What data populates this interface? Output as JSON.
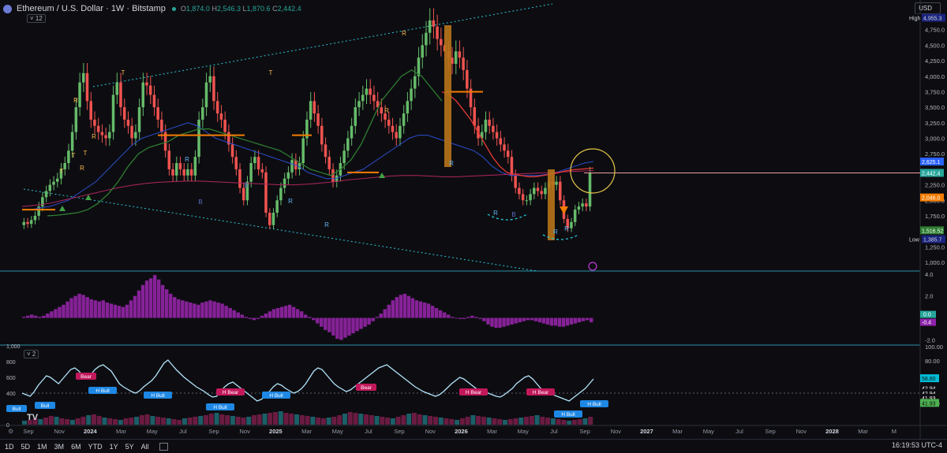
{
  "header": {
    "symbol": "Ethereum / U.S. Dollar · 1W · Bitstamp",
    "o_label": "O",
    "o": "1,874.0",
    "h_label": "H",
    "h": "2,546.3",
    "l_label": "L",
    "l": "1,870.6",
    "c_label": "C",
    "c": "2,442.4",
    "indicator_count": "12"
  },
  "currency": "USD",
  "price_axis": {
    "ticks": [
      "4,750.0",
      "4,500.0",
      "4,250.0",
      "4,000.0",
      "3,750.0",
      "3,500.0",
      "3,250.0",
      "3,000.0",
      "2,750.0",
      "2,250.0",
      "2,000.0",
      "1,750.0",
      "1,250.0",
      "1,000.0"
    ],
    "tick_values": [
      4750,
      4500,
      4250,
      4000,
      3750,
      3500,
      3250,
      3000,
      2750,
      2250,
      2000,
      1750,
      1250,
      1000
    ],
    "high_label": "High",
    "high_value": "4,955.3",
    "low_label": "Low",
    "low_value": "1,385.7",
    "tags": [
      {
        "text": "2,625.1",
        "color": "#2962ff",
        "value": 2625
      },
      {
        "text": "2,442.4",
        "color": "#26a69a",
        "value": 2442
      },
      {
        "text": "2,046.0",
        "color": "#f57c00",
        "value": 2046
      },
      {
        "text": "1,516.52",
        "color": "#2e7d32",
        "value": 1516
      }
    ]
  },
  "macd_axis": {
    "ticks": [
      "4.0",
      "2.0",
      "-2.0"
    ],
    "tick_values": [
      4,
      2,
      -2
    ],
    "zero_tag": "0.0",
    "last_tag": "-0.4"
  },
  "rsi_axis": {
    "ticks": [
      "100.00",
      "80.00",
      "20.00"
    ],
    "tick_values": [
      100,
      80,
      20
    ],
    "tags": [
      {
        "text": "58.80",
        "color": "#00bcd4",
        "value": 58.8
      },
      {
        "text": "42.94",
        "color": "#ffffff",
        "value": 45
      },
      {
        "text": "42.94",
        "color": "#ffffff",
        "value": 38
      },
      {
        "text": "41.93",
        "color": "#ffffff",
        "value": 31
      },
      {
        "text": "41.93",
        "color": "#4caf50",
        "value": 24
      }
    ],
    "left_ticks": [
      "1,000",
      "800",
      "600",
      "400",
      "200",
      "0"
    ],
    "left_values": [
      1000,
      800,
      600,
      400,
      200,
      0
    ],
    "pane_count": "2"
  },
  "time_axis": {
    "labels": [
      "Sep",
      "Nov",
      "2024",
      "Mar",
      "May",
      "Jul",
      "Sep",
      "Nov",
      "2025",
      "Mar",
      "May",
      "Jul",
      "Sep",
      "Nov",
      "2026",
      "Mar",
      "May",
      "Jul",
      "Sep",
      "Nov",
      "2027",
      "Mar",
      "May",
      "Jul",
      "Sep",
      "Nov",
      "2028",
      "Mar",
      "M"
    ],
    "bold": [
      "2024",
      "2025",
      "2026",
      "2027",
      "2028"
    ]
  },
  "timeframes": [
    "1D",
    "5D",
    "1M",
    "3M",
    "6M",
    "YTD",
    "1Y",
    "5Y",
    "All"
  ],
  "clock": "16:19:53 UTC-4",
  "markers": {
    "T": "T",
    "R": "R",
    "B": "B",
    "bull": "Bull",
    "hbull": "H Bull",
    "bear": "Bear",
    "hbear": "H Bear"
  },
  "chart_data": [
    {
      "type": "candlestick",
      "title": "Ethereum / U.S. Dollar · 1W · Bitstamp",
      "x_range": [
        "2023-08",
        "2028-05"
      ],
      "ylim": [
        1000,
        5000
      ],
      "series": [
        {
          "name": "",
          "close": [
            1650,
            1620,
            1680,
            1750,
            1900,
            2050,
            2150,
            2250,
            2300,
            2350,
            2500,
            2600,
            2800,
            3100,
            3500,
            3900,
            4050,
            3600,
            3300,
            3200,
            3100,
            3050,
            3000,
            3100,
            3700,
            3900,
            3500,
            3300,
            3200,
            3000,
            3100,
            3500,
            3900,
            3850,
            3700,
            3500,
            3300,
            3100,
            2800,
            2500,
            2400,
            2600,
            2500,
            2400,
            2500,
            2400,
            2700,
            3300,
            3500,
            3900,
            4000,
            3600,
            3400,
            3300,
            3100,
            2900,
            2700,
            2500,
            2200,
            2000,
            2300,
            2600,
            2700,
            2500,
            2450,
            1800,
            1600,
            1800,
            2000,
            2200,
            2350,
            2450,
            2650,
            2500,
            2600,
            3000,
            3300,
            3600,
            3400,
            3200,
            2900,
            2700,
            2500,
            2300,
            2400,
            2600,
            2800,
            3000,
            3200,
            3500,
            3600,
            3700,
            3800,
            3700,
            3600,
            3500,
            3400,
            3300,
            3200,
            3100,
            3000,
            3200,
            3400,
            3600,
            3800,
            4000,
            4300,
            4500,
            4700,
            4900,
            4800,
            4600,
            4500,
            4400,
            4300,
            4200,
            4400,
            4300,
            4100,
            3800,
            3500,
            3200,
            3000,
            3100,
            3300,
            3200,
            3100,
            3000,
            2900,
            2800,
            2700,
            2400,
            2200,
            2100,
            2000,
            2000,
            2100,
            2200,
            2150,
            2100,
            2200,
            2300,
            2250,
            2300,
            2000,
            1700,
            1550,
            1650,
            1850,
            1900,
            1950,
            1900,
            2442
          ]
        },
        {
          "name": "",
          "values": [
            1850,
            1850,
            1880,
            1900,
            1950,
            2000,
            2100,
            2200,
            2300,
            2450,
            2600,
            2750,
            2900,
            3000,
            3050,
            3100,
            3150,
            3200,
            3250,
            3200,
            3100,
            3000,
            2950,
            2900,
            2850,
            2800,
            2750,
            2700,
            2650,
            2600,
            2550,
            2450,
            2400,
            2350,
            2350,
            2400,
            2450,
            2500,
            2600,
            2700,
            2800,
            2900,
            3000,
            3050,
            3050,
            3000,
            2950,
            2900,
            2850,
            2800,
            2700,
            2550,
            2450,
            2400,
            2400,
            2400,
            2400,
            2420,
            2450,
            2500,
            2550,
            2600,
            2625
          ]
        },
        {
          "name": "",
          "values": [
            1900,
            1920,
            1950,
            2000,
            2050,
            2100,
            2150,
            2200,
            2240,
            2270,
            2290,
            2300,
            2310,
            2310,
            2300,
            2290,
            2280,
            2270,
            2260,
            2250,
            2250,
            2260,
            2280,
            2300,
            2330,
            2350,
            2370,
            2390,
            2400,
            2400,
            2390,
            2380,
            2380,
            2390,
            2400,
            2410,
            2420,
            2430,
            2440,
            2450,
            2460,
            2470,
            2480
          ]
        },
        {
          "name": "",
          "values": [
            1750,
            1760,
            1780,
            1800,
            1850,
            1950,
            2100,
            2300,
            2550,
            2750,
            2850,
            2900,
            2950,
            3050,
            3100,
            3150,
            3150,
            3100,
            3050,
            3000,
            2950,
            2900,
            2850,
            2800,
            2700,
            2600,
            2500,
            2450,
            2400,
            2500,
            2650,
            2900,
            3250,
            3600,
            3800,
            4000,
            4100,
            4000,
            3800,
            3600
          ]
        },
        {
          "name": "",
          "values": [
            3750,
            3700,
            3600,
            3450,
            3300,
            3100,
            2900,
            2700,
            2550,
            2450,
            2420,
            2400,
            2380,
            2380,
            2400,
            2420,
            2440,
            2470,
            2490,
            2500,
            2510,
            2520
          ]
        }
      ]
    },
    {
      "type": "bar",
      "title": "",
      "ylim": [
        -2.4,
        4.2
      ],
      "series": [
        {
          "name": "",
          "values": [
            0.1,
            0.2,
            0.3,
            0.2,
            0.1,
            0.2,
            0.4,
            0.6,
            0.8,
            1.0,
            1.2,
            1.5,
            1.8,
            2.0,
            2.2,
            2.1,
            1.9,
            1.7,
            1.6,
            1.5,
            1.6,
            1.4,
            1.3,
            1.2,
            1.1,
            1.0,
            1.2,
            1.6,
            2.0,
            2.5,
            3.0,
            3.4,
            3.6,
            3.9,
            3.5,
            3.0,
            2.6,
            2.2,
            1.9,
            1.7,
            1.6,
            1.5,
            1.4,
            1.3,
            1.2,
            1.4,
            1.5,
            1.6,
            1.5,
            1.4,
            1.3,
            1.1,
            0.9,
            0.7,
            0.5,
            0.3,
            0.1,
            -0.1,
            -0.2,
            -0.1,
            0.2,
            0.4,
            0.6,
            0.8,
            0.9,
            1.0,
            1.1,
            1.2,
            1.0,
            0.8,
            0.6,
            0.3,
            0.1,
            -0.2,
            -0.5,
            -0.8,
            -1.1,
            -1.3,
            -1.6,
            -1.9,
            -2.0,
            -1.8,
            -1.6,
            -1.4,
            -1.2,
            -1.0,
            -0.8,
            -0.6,
            -0.3,
            0.1,
            0.4,
            0.8,
            1.2,
            1.6,
            1.9,
            2.1,
            2.2,
            2.0,
            1.8,
            1.6,
            1.5,
            1.4,
            1.3,
            1.1,
            0.9,
            0.7,
            0.5,
            0.3,
            0.1,
            0.0,
            -0.1,
            -0.1,
            0.1,
            0.2,
            0.1,
            -0.1,
            -0.3,
            -0.6,
            -0.8,
            -0.9,
            -0.9,
            -0.8,
            -0.7,
            -0.6,
            -0.5,
            -0.4,
            -0.3,
            -0.2,
            -0.2,
            -0.3,
            -0.4,
            -0.5,
            -0.6,
            -0.7,
            -0.7,
            -0.8,
            -0.8,
            -0.7,
            -0.6,
            -0.5,
            -0.4,
            -0.3,
            -0.2,
            -0.4
          ]
        }
      ]
    },
    {
      "type": "line",
      "title": "",
      "ylim": [
        0,
        1000
      ],
      "series": [
        {
          "name": "",
          "values": [
            400,
            380,
            360,
            420,
            500,
            560,
            620,
            600,
            560,
            520,
            580,
            640,
            700,
            720,
            680,
            620,
            600,
            640,
            700,
            740,
            760,
            720,
            680,
            600,
            520,
            480,
            450,
            420,
            400,
            430,
            480,
            520,
            560,
            620,
            700,
            780,
            820,
            760,
            700,
            650,
            600,
            560,
            520,
            480,
            450,
            420,
            380,
            350,
            360,
            420,
            480,
            520,
            540,
            500,
            460,
            420,
            380,
            340,
            300,
            320,
            360,
            420,
            480,
            520,
            500,
            460,
            430,
            400,
            420,
            460,
            520,
            600,
            680,
            720,
            700,
            640,
            580,
            520,
            480,
            450,
            420,
            440,
            480,
            520,
            560,
            600,
            640,
            680,
            720,
            740,
            760,
            720,
            680,
            640,
            600,
            560,
            520,
            480,
            450,
            420,
            400,
            380,
            360,
            380,
            420,
            470,
            520,
            560,
            600,
            580,
            540,
            500,
            460,
            440,
            420,
            400,
            380,
            360,
            350,
            380,
            420,
            460,
            520,
            560,
            600,
            620,
            580,
            520,
            460,
            420,
            400,
            380,
            360,
            340,
            320,
            300,
            340,
            380,
            420,
            460,
            520,
            580
          ]
        },
        {
          "name": "",
          "values": [
            50,
            60,
            80,
            70,
            90,
            110,
            100,
            80,
            70,
            60,
            80,
            100,
            120,
            130,
            110,
            90,
            80,
            70,
            60,
            80,
            90,
            100,
            120,
            130,
            110,
            100,
            90,
            80,
            70,
            60,
            80,
            90,
            100,
            110,
            120,
            140,
            150,
            130,
            120,
            110,
            100,
            90,
            100,
            120,
            130,
            140,
            150,
            160,
            170,
            150,
            140,
            130,
            120,
            110,
            100,
            90,
            80,
            90,
            100,
            120,
            140,
            160,
            150,
            140,
            130,
            120,
            110,
            100,
            90,
            80,
            100,
            120,
            140,
            150,
            130,
            120,
            110,
            100,
            90,
            80,
            70,
            60,
            80,
            100,
            120,
            110,
            100,
            90,
            80,
            70,
            60,
            70,
            80,
            90,
            100,
            110,
            120,
            100,
            90,
            80,
            70,
            60,
            50,
            60,
            70,
            80,
            100
          ]
        }
      ]
    }
  ]
}
